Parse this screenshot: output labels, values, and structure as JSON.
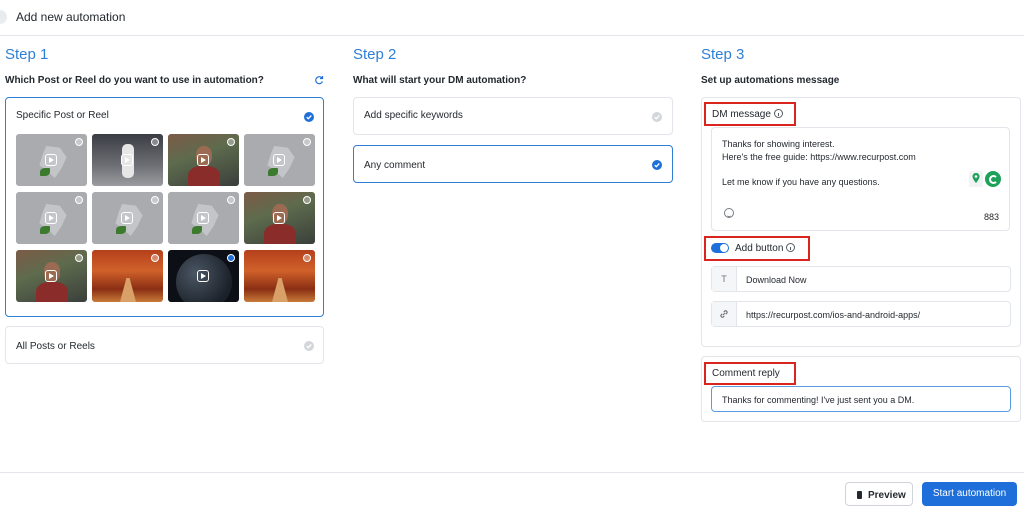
{
  "header": {
    "title": "Add new automation"
  },
  "step1": {
    "title": "Step 1",
    "question": "Which Post or Reel do you want to use in automation?",
    "specific_label": "Specific Post or Reel",
    "all_label": "All Posts or Reels",
    "thumbnails": [
      "gray-placeholder",
      "runner",
      "person-selfie",
      "gray-placeholder",
      "gray-placeholder",
      "gray-placeholder",
      "gray-placeholder",
      "person-selfie",
      "person-selfie",
      "autumn-path",
      "moon-dark",
      "autumn-path"
    ],
    "selected_thumbnail_index": 10
  },
  "step2": {
    "title": "Step 2",
    "question": "What will start your DM automation?",
    "keywords_label": "Add specific keywords",
    "any_comment_label": "Any comment"
  },
  "step3": {
    "title": "Step 3",
    "question": "Set up automations message",
    "dm_label": "DM message",
    "dm_lines": [
      "Thanks for showing interest.",
      "Here's the free guide: https://www.recurpost.com",
      "Let me know if you have any questions."
    ],
    "char_count": "883",
    "add_button_label": "Add button",
    "button_prefix": "T",
    "button_text": "Download Now",
    "button_url": "https://recurpost.com/ios-and-android-apps/",
    "comment_reply_label": "Comment reply",
    "comment_reply_text": "Thanks for commenting! I've just sent you a DM."
  },
  "footer": {
    "preview_label": "Preview",
    "start_label": "Start automation"
  },
  "colors": {
    "accent": "#1e6fd9",
    "step_heading": "#2f7fd6",
    "highlight": "#d9251d"
  }
}
